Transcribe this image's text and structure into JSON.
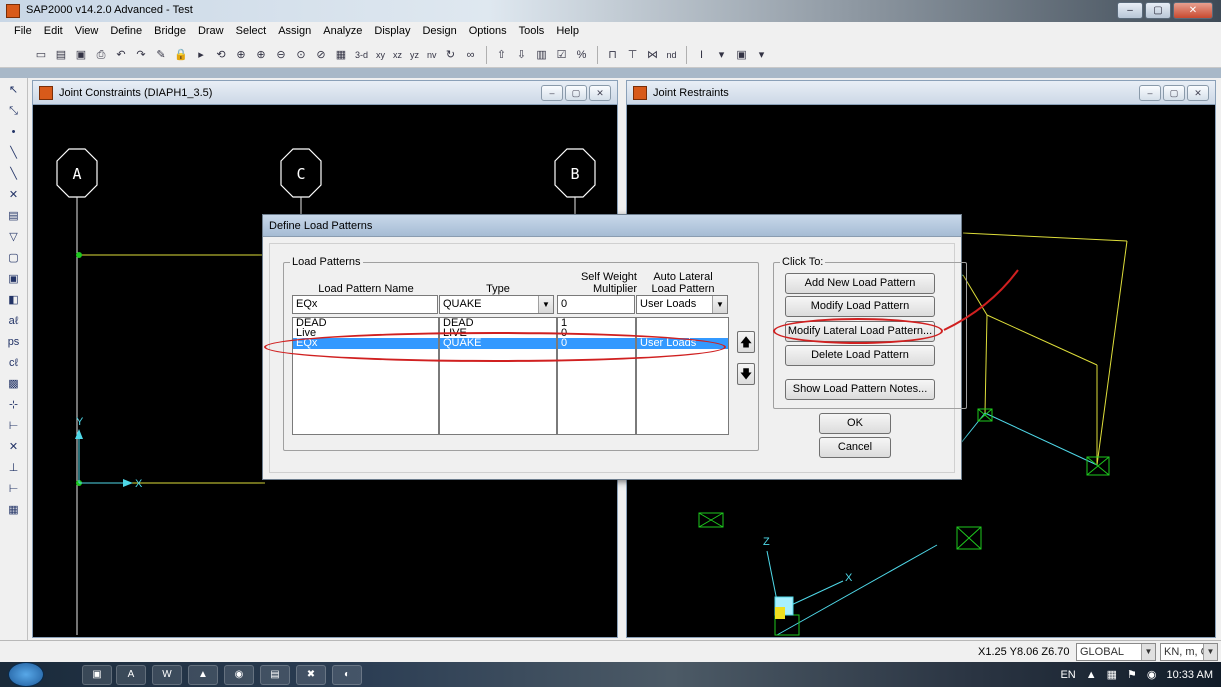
{
  "app": {
    "title": "SAP2000 v14.2.0 Advanced  - Test",
    "window_buttons": [
      "–",
      "▢",
      "✕"
    ]
  },
  "menu": [
    "File",
    "Edit",
    "View",
    "Define",
    "Bridge",
    "Draw",
    "Select",
    "Assign",
    "Analyze",
    "Display",
    "Design",
    "Options",
    "Tools",
    "Help"
  ],
  "toolbar": {
    "view_buttons": [
      "3-d",
      "xy",
      "xz",
      "yz",
      "nv"
    ],
    "units_hint": "nd"
  },
  "windows": {
    "left": {
      "title": "Joint Constraints (DIAPH1_3.5)",
      "grid_labels": [
        "A",
        "C",
        "B"
      ],
      "axis_x": "X",
      "axis_y": "Y"
    },
    "right": {
      "title": "Joint Restraints",
      "axis_x": "X",
      "axis_z": "Z"
    }
  },
  "dialog": {
    "title": "Define Load Patterns",
    "load_patterns_group": "Load Patterns",
    "headers": {
      "name": "Load Pattern Name",
      "type": "Type",
      "self_weight_1": "Self Weight",
      "self_weight_2": "Multiplier",
      "auto_lateral_1": "Auto Lateral",
      "auto_lateral_2": "Load Pattern"
    },
    "edit_row": {
      "name": "EQx",
      "type": "QUAKE",
      "multiplier": "0",
      "auto_lateral": "User Loads"
    },
    "rows": [
      {
        "name": "DEAD",
        "type": "DEAD",
        "multiplier": "1",
        "auto_lateral": ""
      },
      {
        "name": "Live",
        "type": "LIVE",
        "multiplier": "0",
        "auto_lateral": ""
      },
      {
        "name": "EQx",
        "type": "QUAKE",
        "multiplier": "0",
        "auto_lateral": "User Loads",
        "selected": true
      }
    ],
    "click_to_group": "Click To:",
    "buttons": {
      "add": "Add New Load Pattern",
      "modify": "Modify Load Pattern",
      "modify_lateral": "Modify Lateral Load Pattern...",
      "delete": "Delete Load Pattern",
      "notes": "Show Load Pattern Notes...",
      "ok": "OK",
      "cancel": "Cancel"
    }
  },
  "status": {
    "coords": "X1.25  Y8.06  Z6.70",
    "coord_system": "GLOBAL",
    "units": "KN, m, C"
  },
  "taskbar": {
    "lang": "EN",
    "time": "10:33 AM"
  },
  "colors": {
    "selection": "#3399ff",
    "annotation_red": "#d02020",
    "grid_line": "#dede3a",
    "frame_cyan": "#4fd8e8",
    "restraint_green": "#1ec81e"
  }
}
